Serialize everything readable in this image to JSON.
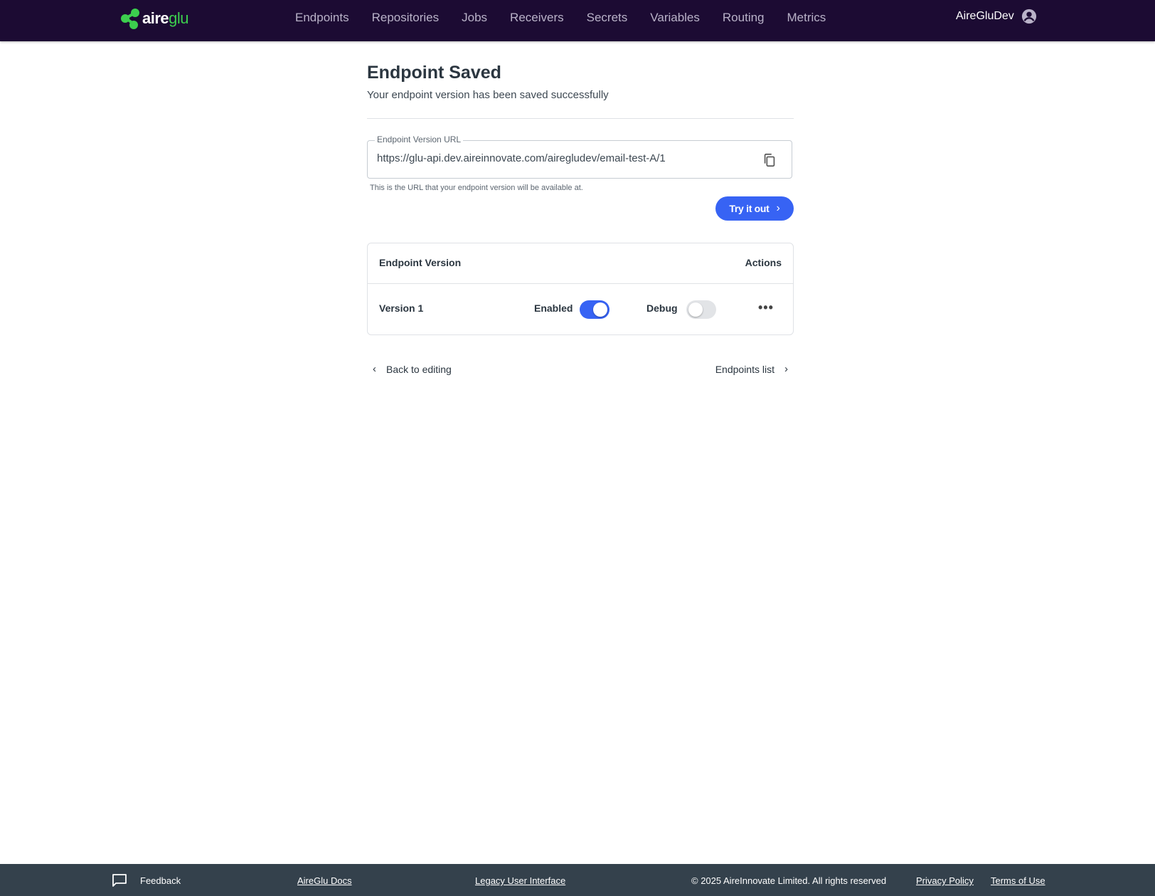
{
  "brand": {
    "aire": "aire",
    "glu": "glu",
    "logo_green": "#3ccf4e"
  },
  "nav": {
    "items": [
      "Endpoints",
      "Repositories",
      "Jobs",
      "Receivers",
      "Secrets",
      "Variables",
      "Routing",
      "Metrics"
    ]
  },
  "user": {
    "name": "AireGluDev",
    "icon": "account-circle-icon"
  },
  "page": {
    "title": "Endpoint Saved",
    "subtitle": "Your endpoint version has been saved successfully"
  },
  "url_field": {
    "label": "Endpoint Version URL",
    "value": "https://glu-api.dev.aireinnovate.com/airegludev/email-test-A/1",
    "helper": "This is the URL that your endpoint version will be available at.",
    "copy_icon": "copy-icon"
  },
  "try_button": {
    "label": "Try it out",
    "accent": "#3763f4"
  },
  "versions_table": {
    "headers": {
      "version": "Endpoint Version",
      "actions": "Actions"
    },
    "rows": [
      {
        "version": "Version 1",
        "enabled_label": "Enabled",
        "enabled": true,
        "debug_label": "Debug",
        "debug": false,
        "more": "•••"
      }
    ]
  },
  "links": {
    "back": "Back to editing",
    "list": "Endpoints list"
  },
  "footer": {
    "feedback": "Feedback",
    "docs": "AireGlu Docs",
    "legacy": "Legacy User Interface",
    "copyright": "© 2025 AireInnovate Limited. All rights reserved",
    "privacy": "Privacy Policy",
    "terms": "Terms of Use"
  },
  "colors": {
    "header_bg": "#1c0b33",
    "footer_bg": "#34414c",
    "toggle_on": "#3763f4"
  }
}
